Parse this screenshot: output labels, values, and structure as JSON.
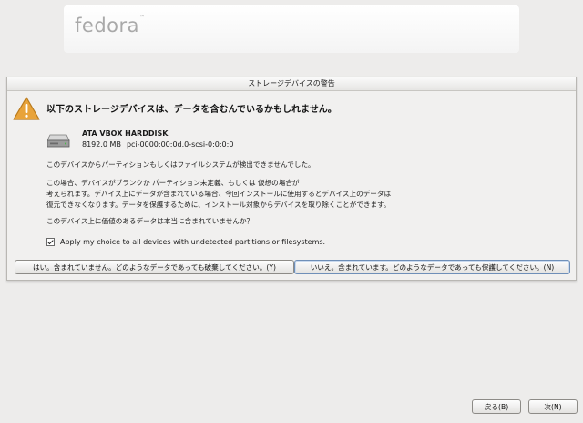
{
  "header": {
    "logo_text": "fedora",
    "logo_tm": "™"
  },
  "dialog": {
    "title": "ストレージデバイスの警告",
    "heading": "以下のストレージデバイスは、データを含むんでいるかもしれません。",
    "icon": "warning-icon",
    "device": {
      "icon": "harddisk-icon",
      "name": "ATA VBOX HARDDISK",
      "size": "8192.0 MB",
      "path": "pci-0000:00:0d.0-scsi-0:0:0:0"
    },
    "paragraph1": "このデバイスからパーティションもしくはファイルシステムが検出できませんでした。",
    "paragraph2_lines": [
      "この場合、デバイスがブランクか パーティション未定義、もしくは 仮想の場合が",
      "考えられます。デバイス上にデータが含まれている場合、今回インストールに使用するとデバイス上のデータは",
      "復元できなくなります。データを保護するために、インストール対象からデバイスを取り除くことができます。"
    ],
    "question": "このデバイス上に価値のあるデータは本当に含まれていませんか？",
    "checkbox_label": "Apply my choice to all devices with undetected partitions or filesystems.",
    "checkbox_checked": true,
    "button_no": "はい。含まれていません。どのようなデータであっても破棄してください。(Y)",
    "button_yes": "いいえ。含まれています。どのようなデータであっても保護してください。(N)"
  },
  "nav": {
    "back_label": "戻る(B)",
    "next_label": "次(N)"
  },
  "colors": {
    "background": "#edeceb",
    "warning": "#e8a33a",
    "focus_border": "#6f8fb8"
  }
}
